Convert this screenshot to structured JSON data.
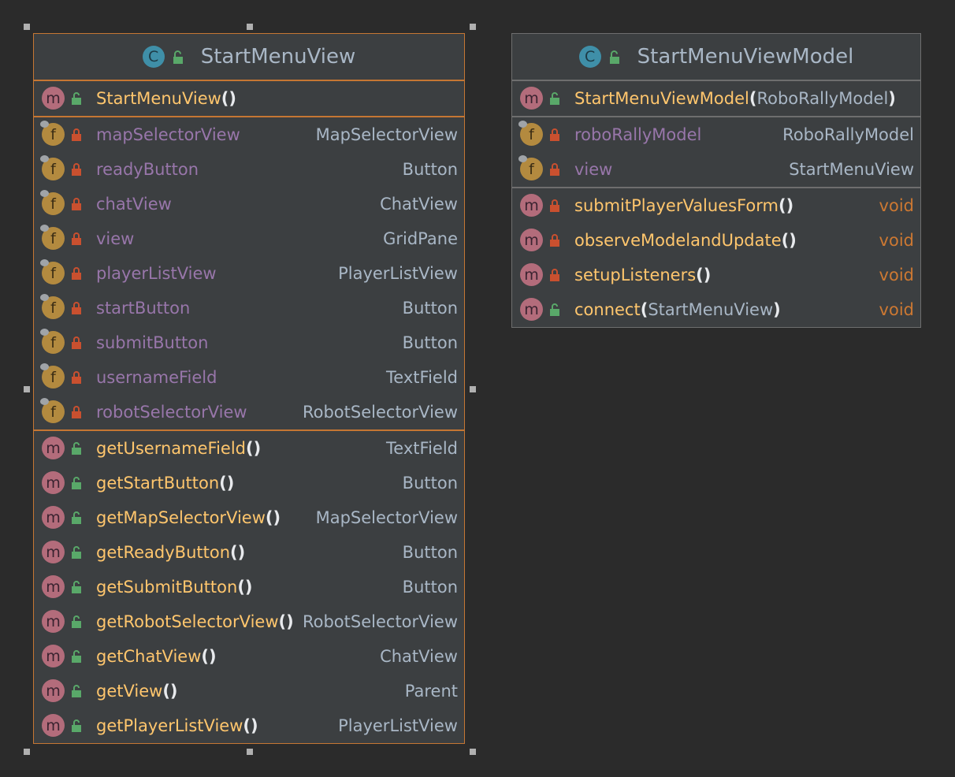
{
  "view": {
    "name": "StartMenuView",
    "constructors": [
      {
        "name": "StartMenuView",
        "paren": "()"
      }
    ],
    "fields": [
      {
        "name": "mapSelectorView",
        "type": "MapSelectorView"
      },
      {
        "name": "readyButton",
        "type": "Button"
      },
      {
        "name": "chatView",
        "type": "ChatView"
      },
      {
        "name": "view",
        "type": "GridPane"
      },
      {
        "name": "playerListView",
        "type": "PlayerListView"
      },
      {
        "name": "startButton",
        "type": "Button"
      },
      {
        "name": "submitButton",
        "type": "Button"
      },
      {
        "name": "usernameField",
        "type": "TextField"
      },
      {
        "name": "robotSelectorView",
        "type": "RobotSelectorView"
      }
    ],
    "methods": [
      {
        "name": "getUsernameField",
        "paren": "()",
        "type": "TextField"
      },
      {
        "name": "getStartButton",
        "paren": "()",
        "type": "Button"
      },
      {
        "name": "getMapSelectorView",
        "paren": "()",
        "type": "MapSelectorView"
      },
      {
        "name": "getReadyButton",
        "paren": "()",
        "type": "Button"
      },
      {
        "name": "getSubmitButton",
        "paren": "()",
        "type": "Button"
      },
      {
        "name": "getRobotSelectorView",
        "paren": "()",
        "type": "RobotSelectorView"
      },
      {
        "name": "getChatView",
        "paren": "()",
        "type": "ChatView"
      },
      {
        "name": "getView",
        "paren": "()",
        "type": "Parent"
      },
      {
        "name": "getPlayerListView",
        "paren": "()",
        "type": "PlayerListView"
      }
    ]
  },
  "viewmodel": {
    "name": "StartMenuViewModel",
    "constructor": {
      "name": "StartMenuViewModel",
      "open": "(",
      "param": "RoboRallyModel",
      "close": ")"
    },
    "fields": [
      {
        "name": "roboRallyModel",
        "type": "RoboRallyModel"
      },
      {
        "name": "view",
        "type": "StartMenuView"
      }
    ],
    "methods": [
      {
        "name": "submitPlayerValuesForm",
        "open": "()",
        "param": "",
        "close": "",
        "type": "void",
        "access": "private"
      },
      {
        "name": "observeModelandUpdate",
        "open": "()",
        "param": "",
        "close": "",
        "type": "void",
        "access": "private"
      },
      {
        "name": "setupListeners",
        "open": "()",
        "param": "",
        "close": "",
        "type": "void",
        "access": "private"
      },
      {
        "name": "connect",
        "open": "(",
        "param": "StartMenuView",
        "close": ")",
        "type": "void",
        "access": "public"
      }
    ]
  },
  "icons": {
    "class_badge": "C",
    "method_badge": "m",
    "field_badge": "f",
    "public_lock": "open-lock-icon",
    "private_lock": "closed-lock-icon"
  },
  "colors": {
    "background": "#2b2b2b",
    "panel": "#3c3f41",
    "selected_border": "#c57633",
    "field_name": "#9876aa",
    "method_name": "#ffc66d",
    "type_text": "#a9b7c6",
    "void": "#cc7832",
    "public_lock": "#59a869",
    "private_lock": "#c9502f"
  }
}
